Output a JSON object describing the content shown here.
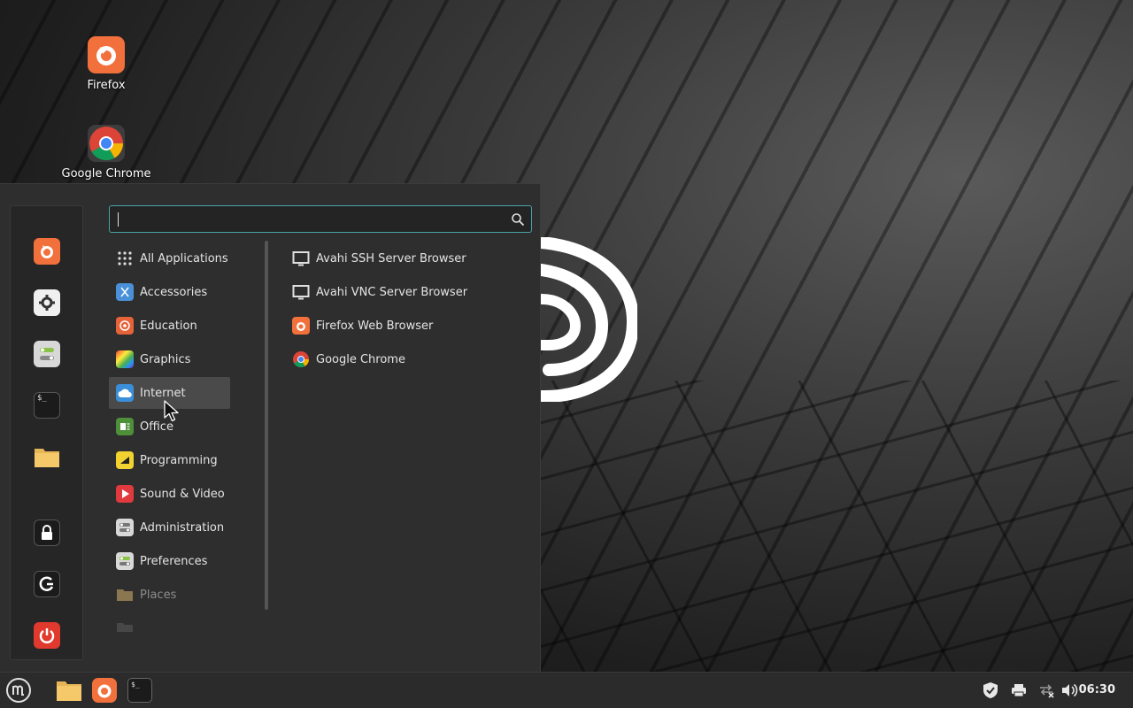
{
  "desktop": {
    "icons": [
      {
        "label": "Firefox",
        "icon": "firefox-icon"
      },
      {
        "label": "Google Chrome",
        "icon": "chrome-icon"
      }
    ]
  },
  "menu": {
    "search": {
      "value": "",
      "placeholder": ""
    },
    "favorites": [
      {
        "icon": "firefox-icon"
      },
      {
        "icon": "settings-icon"
      },
      {
        "icon": "control-center-icon"
      },
      {
        "icon": "terminal-icon"
      },
      {
        "icon": "folder-icon"
      },
      {
        "icon": "lock-icon"
      },
      {
        "icon": "logout-icon"
      },
      {
        "icon": "power-icon"
      }
    ],
    "categories": [
      {
        "label": "All Applications",
        "icon": "grid-icon"
      },
      {
        "label": "Accessories",
        "icon": "accessories-icon"
      },
      {
        "label": "Education",
        "icon": "education-icon"
      },
      {
        "label": "Graphics",
        "icon": "graphics-icon"
      },
      {
        "label": "Internet",
        "icon": "internet-icon",
        "active": true
      },
      {
        "label": "Office",
        "icon": "office-icon"
      },
      {
        "label": "Programming",
        "icon": "programming-icon"
      },
      {
        "label": "Sound & Video",
        "icon": "sound-video-icon"
      },
      {
        "label": "Administration",
        "icon": "administration-icon"
      },
      {
        "label": "Preferences",
        "icon": "preferences-icon"
      },
      {
        "label": "Places",
        "icon": "places-icon"
      }
    ],
    "apps": [
      {
        "label": "Avahi SSH Server Browser",
        "icon": "monitor-icon"
      },
      {
        "label": "Avahi VNC Server Browser",
        "icon": "monitor-icon"
      },
      {
        "label": "Firefox Web Browser",
        "icon": "firefox-icon"
      },
      {
        "label": "Google Chrome",
        "icon": "chrome-icon"
      }
    ]
  },
  "panel": {
    "launchers": [
      "menu-icon",
      "files-icon",
      "firefox-icon",
      "terminal-icon"
    ],
    "tray": [
      "shield-icon",
      "printer-icon",
      "network-icon",
      "volume-icon"
    ],
    "clock": "06:30"
  },
  "colors": {
    "accent": "#4aa3a8",
    "firefox": "#f2703c",
    "panel": "#2b2b2b",
    "menu": "#2e2e2e"
  }
}
